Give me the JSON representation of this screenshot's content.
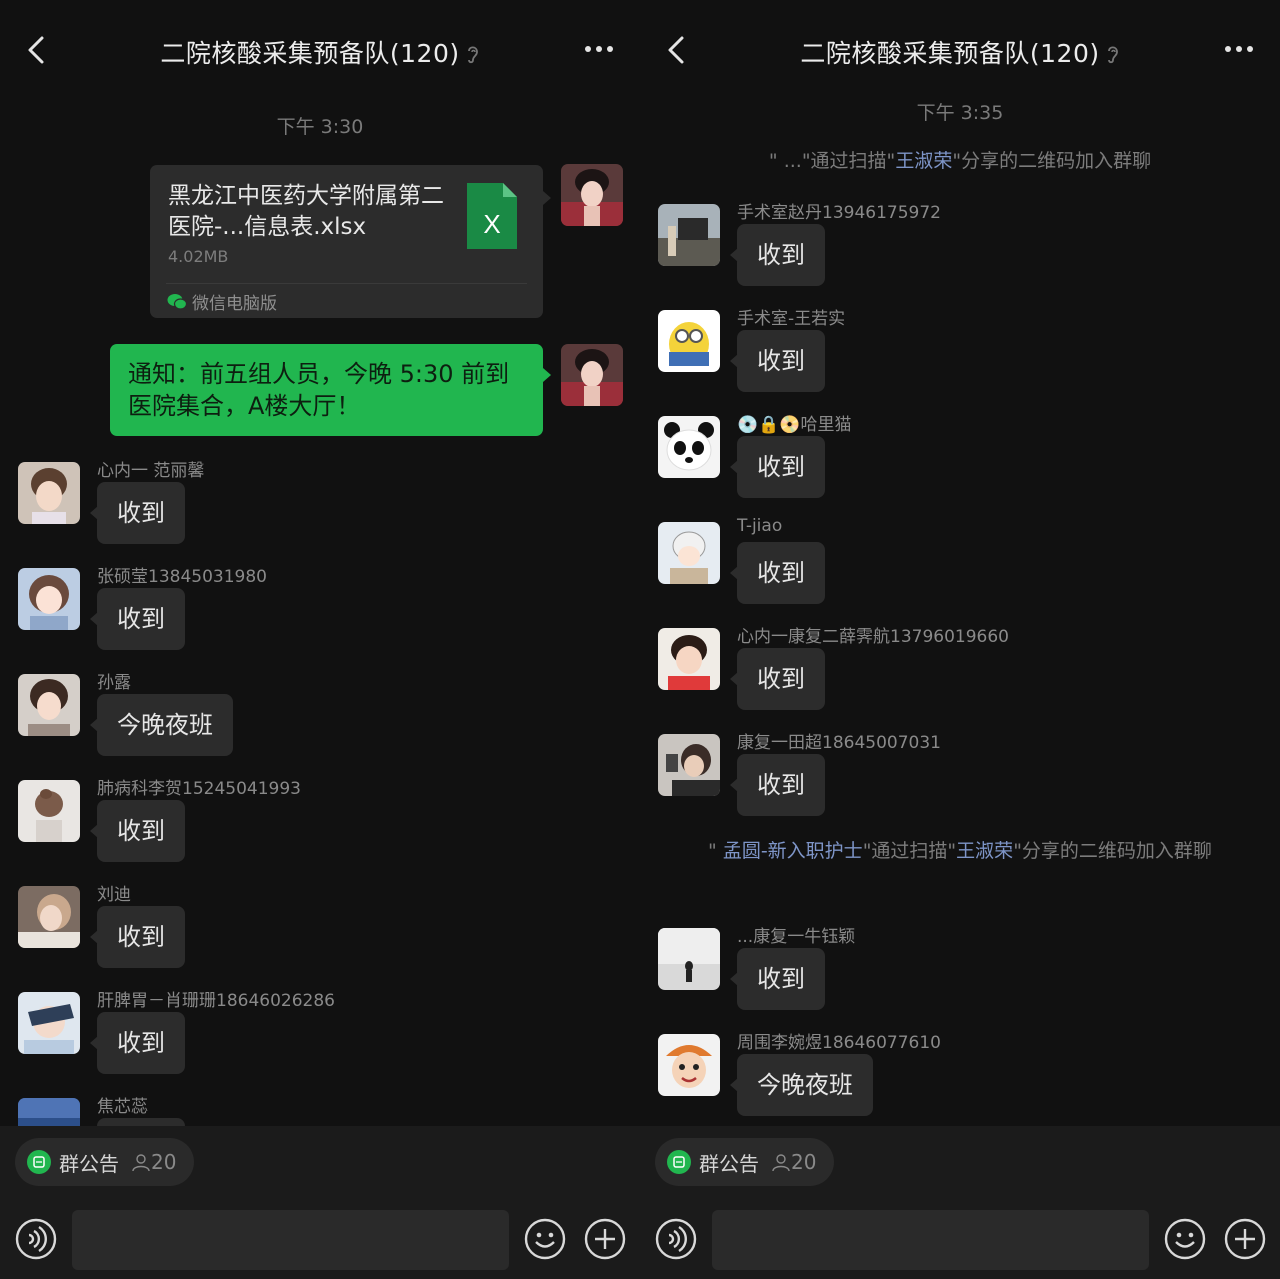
{
  "left": {
    "title": "二院核酸采集预备队(120)",
    "time": "下午 3:30",
    "file": {
      "name": "黑龙江中医药大学附属第二医院-...信息表.xlsx",
      "size": "4.02MB",
      "source": "微信电脑版",
      "icon_label": "X"
    },
    "notice_msg": "通知：前五组人员，今晚 5:30 前到医院集合，A楼大厅！",
    "messages": [
      {
        "sender": "心内一 范丽馨",
        "text": "收到"
      },
      {
        "sender": "张硕莹13845031980",
        "text": "收到"
      },
      {
        "sender": "孙露",
        "text": "今晚夜班"
      },
      {
        "sender": "肺病科李贺15245041993",
        "text": "收到"
      },
      {
        "sender": "刘迪",
        "text": "收到"
      },
      {
        "sender": "肝脾胃－肖珊珊18646026286",
        "text": "收到"
      },
      {
        "sender": "焦芯蕊",
        "text": ""
      }
    ],
    "group_notice": "群公告",
    "member_count": "20"
  },
  "right": {
    "title": "二院核酸采集预备队(120)",
    "time": "下午 3:35",
    "sys1": {
      "prefix": "\" ...\"通过扫描\"",
      "link": "王淑荣",
      "suffix": "\"分享的二维码加入群聊"
    },
    "messages_a": [
      {
        "sender": "手术室赵丹13946175972",
        "text": "收到"
      },
      {
        "sender": "手术室-王若实",
        "text": "收到"
      },
      {
        "sender": "💿🔒📀哈里猫",
        "text": "收到"
      },
      {
        "sender": "T-jiao",
        "text": "收到"
      },
      {
        "sender": "心内一康复二薛霁航13796019660",
        "text": "收到"
      },
      {
        "sender": "康复一田超18645007031",
        "text": "收到"
      }
    ],
    "sys2": {
      "prefix": "\" ",
      "link1": "孟圆-新入职护士",
      "mid": "\"通过扫描\"",
      "link2": "王淑荣",
      "suffix": "\"分享的二维码加入群聊"
    },
    "messages_b": [
      {
        "sender": "...康复一牛钰颖",
        "text": "收到"
      },
      {
        "sender": "周围李婉煜18646077610",
        "text": "今晚夜班"
      }
    ],
    "group_notice": "群公告",
    "member_count": "20"
  },
  "colors": {
    "accent": "#21b64f",
    "bubble": "#2c2c2c",
    "background": "#111111",
    "link": "#7e95c8"
  },
  "icons": [
    "back-arrow-icon",
    "ear-icon",
    "more-icon",
    "excel-file-icon",
    "wechat-icon",
    "notice-icon",
    "person-icon",
    "voice-icon",
    "emoji-icon",
    "plus-icon"
  ]
}
